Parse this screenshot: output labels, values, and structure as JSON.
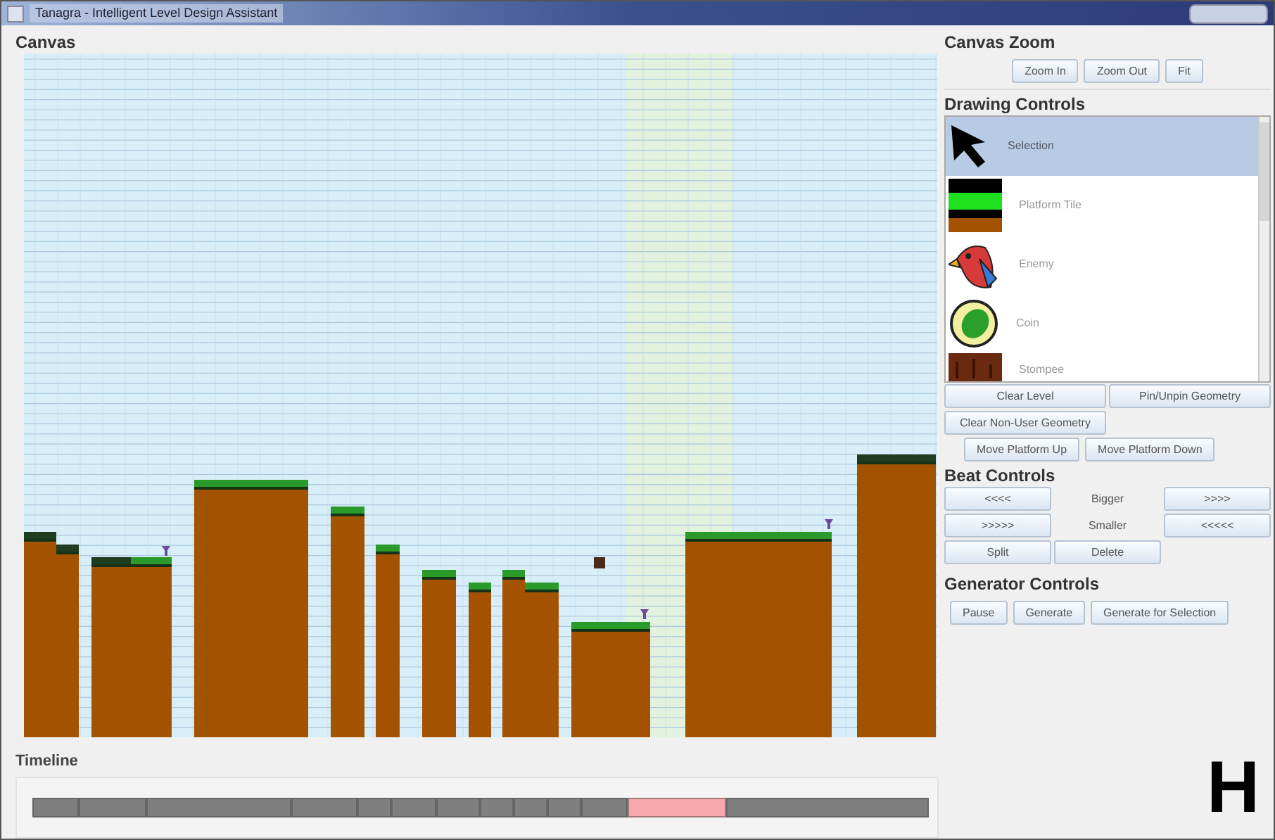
{
  "window": {
    "title": "Tanagra - Intelligent Level Design Assistant"
  },
  "canvas": {
    "title": "Canvas"
  },
  "timeline": {
    "title": "Timeline",
    "segments": [
      {
        "selected": false
      },
      {
        "selected": false
      },
      {
        "selected": false
      },
      {
        "selected": false
      },
      {
        "selected": false
      },
      {
        "selected": false
      },
      {
        "selected": false
      },
      {
        "selected": false
      },
      {
        "selected": false
      },
      {
        "selected": false
      },
      {
        "selected": false
      },
      {
        "selected": true
      },
      {
        "selected": false
      }
    ]
  },
  "canvas_zoom": {
    "title": "Canvas Zoom",
    "buttons": [
      "Zoom In",
      "Zoom Out",
      "Fit"
    ]
  },
  "drawing_controls": {
    "title": "Drawing Controls",
    "items": [
      {
        "kind": "selection",
        "label": "Selection",
        "selected": true
      },
      {
        "kind": "platform",
        "label": "Platform Tile",
        "selected": false
      },
      {
        "kind": "enemy",
        "label": "Enemy",
        "selected": false
      },
      {
        "kind": "coin",
        "label": "Coin",
        "selected": false
      },
      {
        "kind": "stompee",
        "label": "Stompee",
        "selected": false
      }
    ],
    "buttons": [
      [
        "Clear Level",
        "Pin/Unpin Geometry"
      ],
      [
        "Clear Non-User Geometry"
      ],
      [
        "Move Platform Up",
        "Move Platform Down"
      ]
    ]
  },
  "beat_controls": {
    "title": "Beat Controls",
    "rows": [
      [
        "<<<<",
        "Bigger",
        ">>>>"
      ],
      [
        ">>>>>",
        "Smaller",
        "<<<<<"
      ]
    ],
    "buttons": [
      "Split",
      "Delete"
    ]
  },
  "generator_controls": {
    "title": "Generator Controls",
    "buttons": [
      "Pause",
      "Generate",
      "Generate for Selection"
    ]
  },
  "figure_label": "H"
}
